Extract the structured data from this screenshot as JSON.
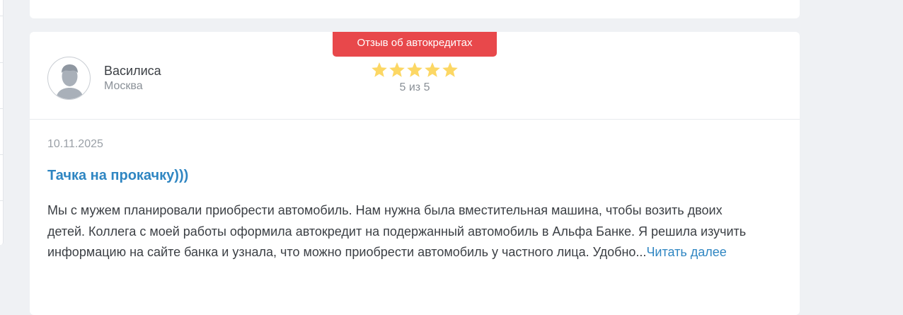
{
  "review": {
    "category_label": "Отзыв об автокредитах",
    "author": {
      "name": "Василиса",
      "city": "Москва",
      "avatar_icon": "user-silhouette-icon"
    },
    "rating": {
      "value": 5,
      "max": 5,
      "text": "5 из 5",
      "star_icon": "star-icon",
      "star_color": "#fcd764"
    },
    "date": "10.11.2025",
    "title": "Тачка на прокачку)))",
    "text": "Мы с мужем планировали приобрести автомобиль. Нам нужна была вместительная машина, чтобы возить двоих детей. Коллега с моей работы оформила автокредит на подержанный автомобиль в Альфа Банке. Я решила изучить информацию на сайте банка и узнала, что можно приобрести автомобиль у частного лица. Удобно...",
    "read_more_label": "Читать далее"
  },
  "colors": {
    "badge": "#e8484b",
    "link": "#2f86c2",
    "page_background": "#eff1f4"
  }
}
